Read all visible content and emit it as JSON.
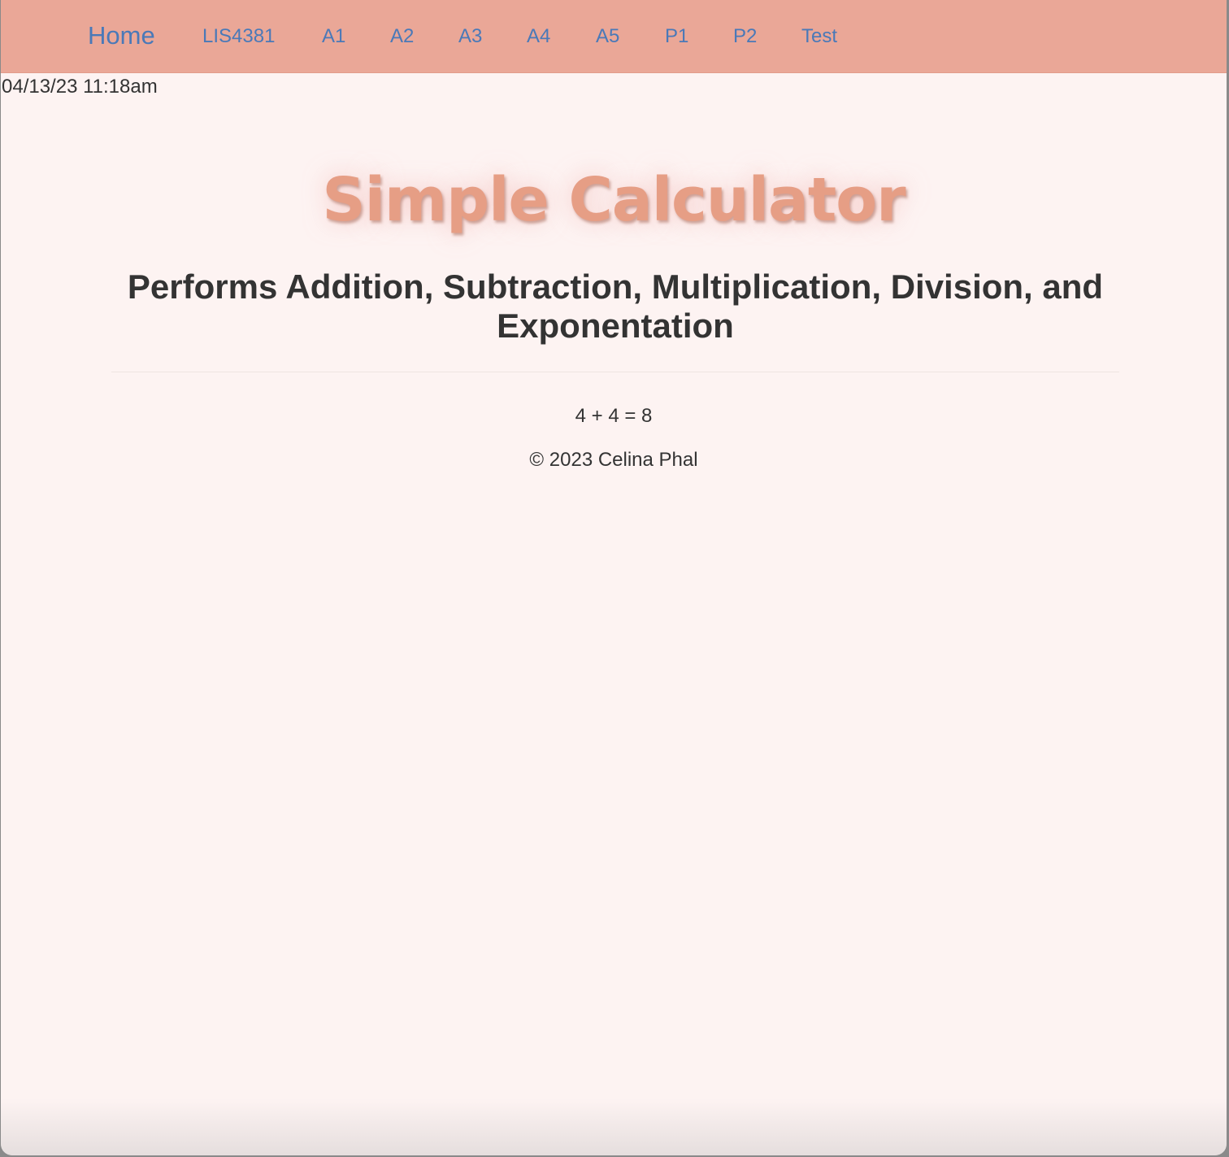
{
  "navbar": {
    "brand": "Home",
    "items": [
      "LIS4381",
      "A1",
      "A2",
      "A3",
      "A4",
      "A5",
      "P1",
      "P2",
      "Test"
    ]
  },
  "datetime": "04/13/23 11:18am",
  "main": {
    "title": "Simple Calculator",
    "subtitle": "Performs Addition, Subtraction, Multiplication, Division, and Exponentation",
    "result": "4 + 4 = 8"
  },
  "footer": {
    "copyright": "© 2023 Celina Phal"
  },
  "colors": {
    "navbar_bg": "#eaa797",
    "link": "#4a79b8",
    "page_bg": "#fdf3f2",
    "title": "#e69e85",
    "text": "#333333"
  }
}
